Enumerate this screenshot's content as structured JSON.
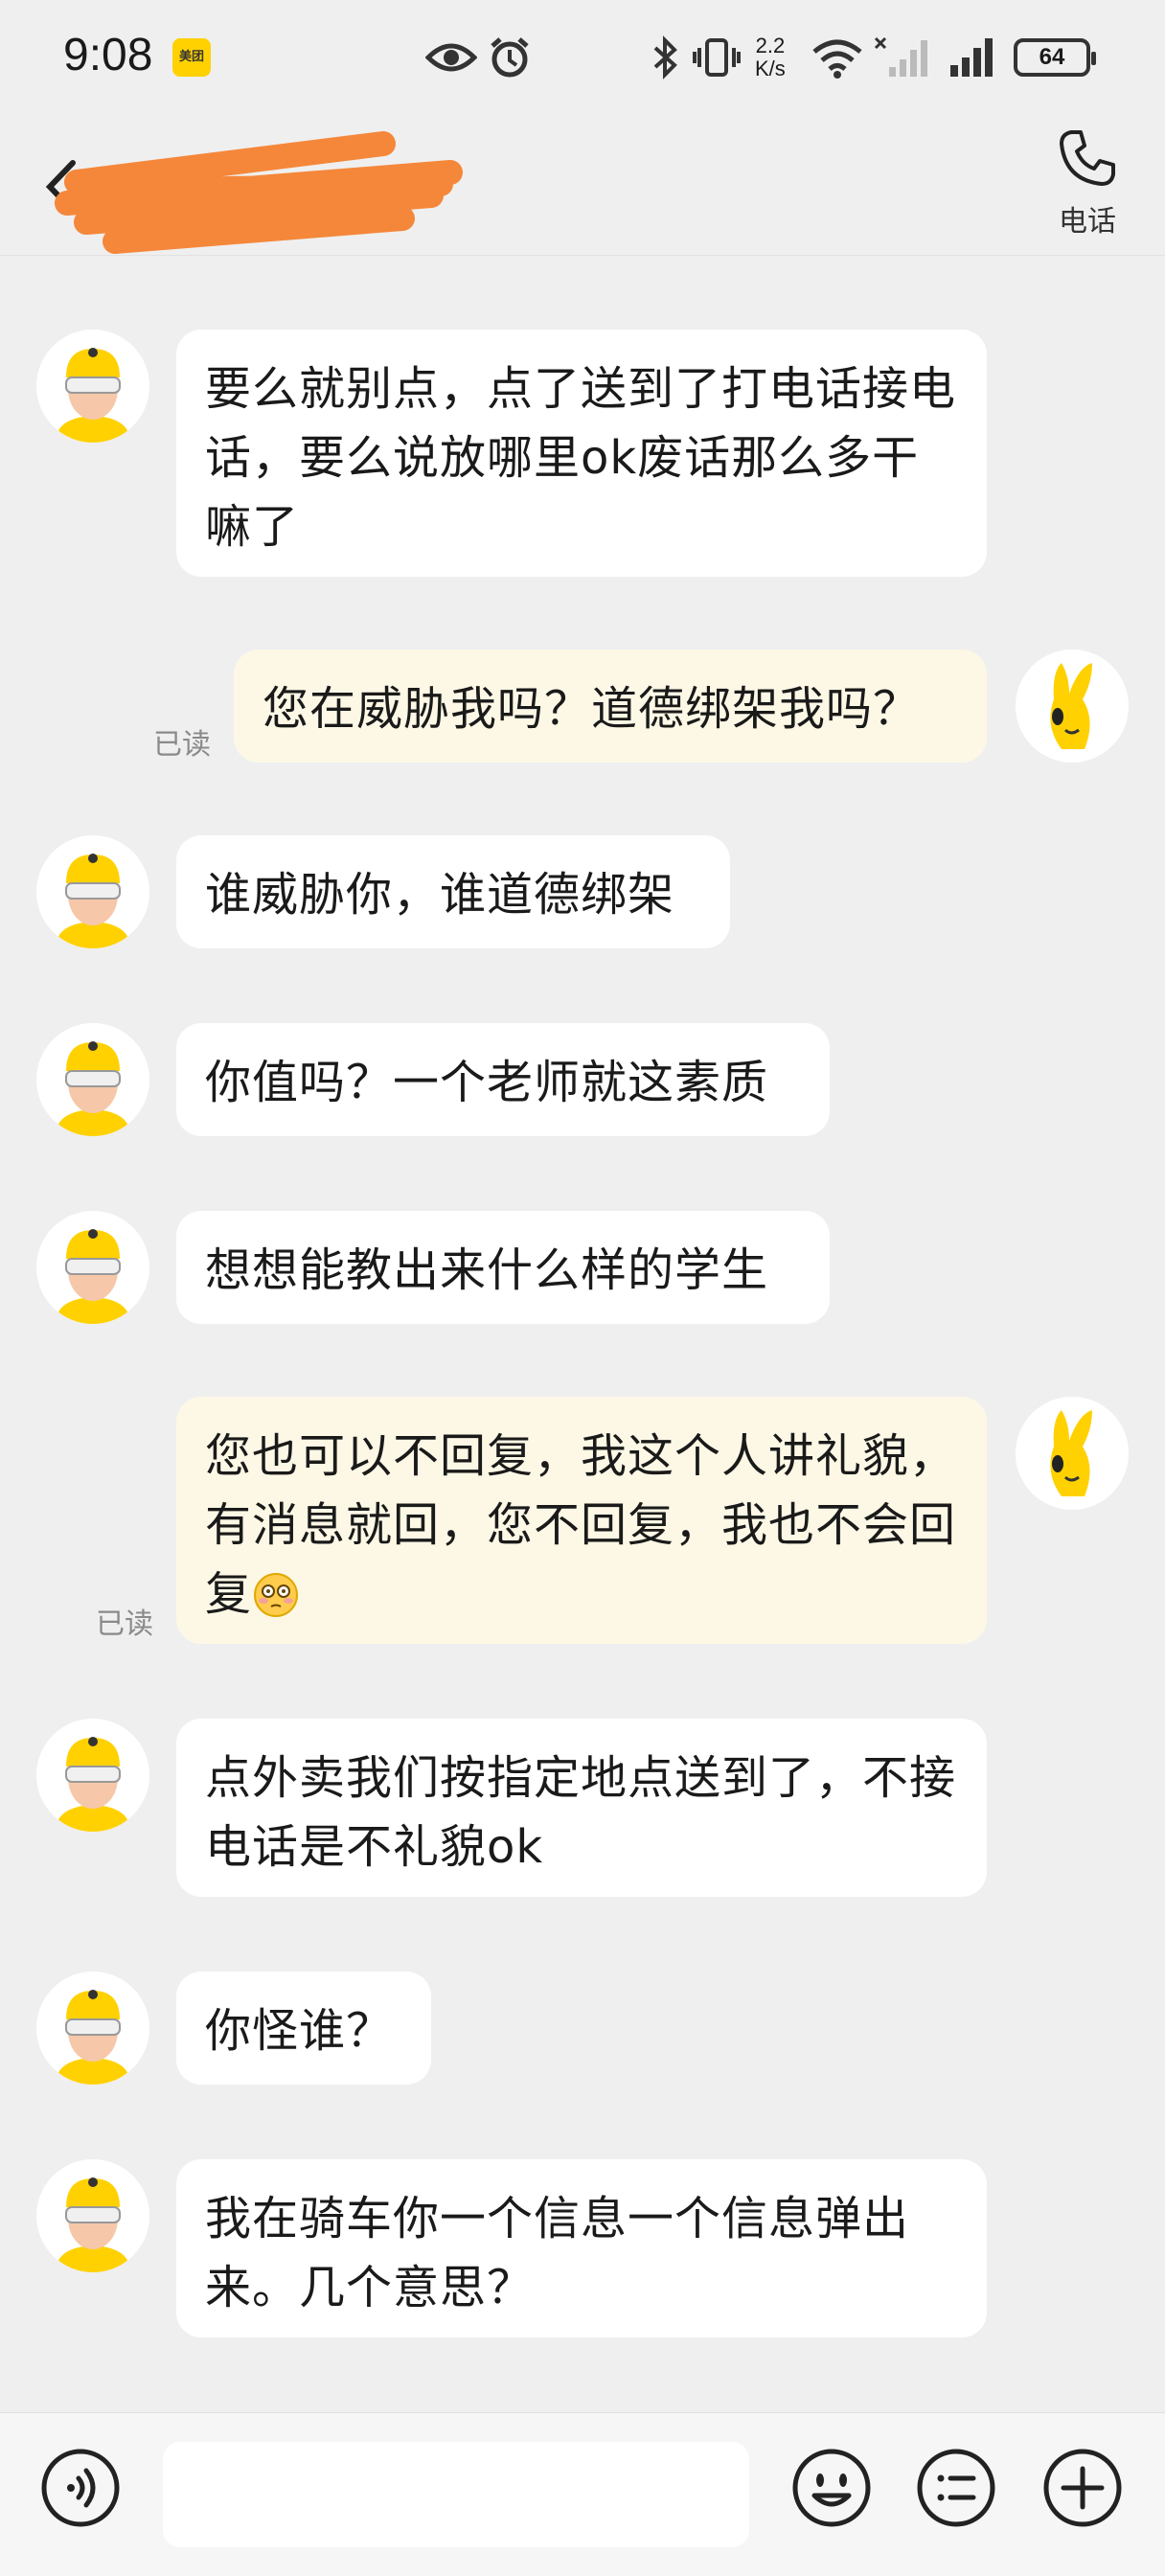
{
  "status_bar": {
    "time": "9:08",
    "app_badge": "美团",
    "net_speed_value": "2.2",
    "net_speed_unit": "K/s",
    "battery": "64"
  },
  "header": {
    "title": "",
    "call_label": "电话"
  },
  "messages": [
    {
      "side": "in",
      "text": "要么就别点，点了送到了打电话接电话，要么说放哪里ok废话那么多干嘛了"
    },
    {
      "side": "out",
      "text": "您在威胁我吗？道德绑架我吗？",
      "read": "已读"
    },
    {
      "side": "in",
      "text": "谁威胁你，谁道德绑架"
    },
    {
      "side": "in",
      "text": "你值吗？一个老师就这素质"
    },
    {
      "side": "in",
      "text": "想想能教出来什么样的学生"
    },
    {
      "side": "out",
      "text": "您也可以不回复，我这个人讲礼貌，有消息就回，您不回复，我也不会回复",
      "emoji": "flushed-face",
      "read": "已读"
    },
    {
      "side": "in",
      "text": "点外卖我们按指定地点送到了，不接电话是不礼貌ok"
    },
    {
      "side": "in",
      "text": "你怪谁？"
    },
    {
      "side": "in",
      "text": "我在骑车你一个信息一个信息弹出来。几个意思？"
    }
  ],
  "input": {
    "placeholder": "",
    "value": ""
  },
  "icons": {
    "voice": "voice-icon",
    "emoji": "emoji-icon",
    "quick_reply": "quick-reply-icon",
    "more": "plus-icon"
  },
  "colors": {
    "background": "#efefef",
    "bubble_in": "#ffffff",
    "bubble_out": "#fdf8e6",
    "brand_yellow": "#ffd100"
  }
}
